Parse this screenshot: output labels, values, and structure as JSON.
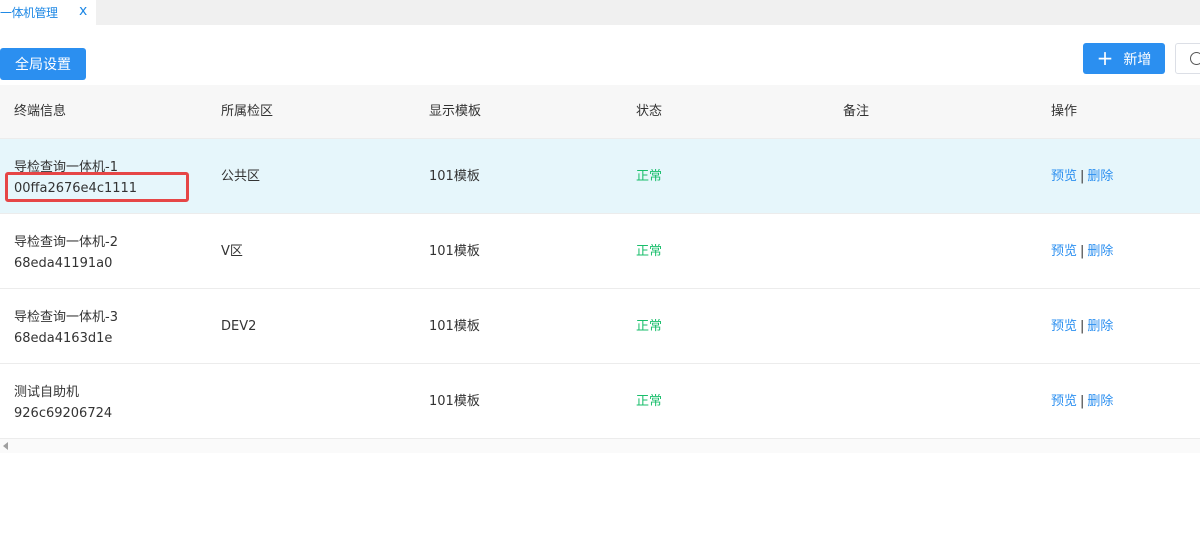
{
  "tabs": [
    {
      "label": "一体机管理",
      "close": "x"
    }
  ],
  "toolbar": {
    "global_settings": "全局设置",
    "add_label": "新增",
    "add_icon": "plus-icon"
  },
  "columns": [
    "终端信息",
    "所属检区",
    "显示模板",
    "状态",
    "备注",
    "操作"
  ],
  "rows": [
    {
      "name": "导检查询一体机-1",
      "id": "00ffa2676e4c1111",
      "area": "公共区",
      "template": "101模板",
      "status": "正常",
      "note": ""
    },
    {
      "name": "导检查询一体机-2",
      "id": "68eda41191a0",
      "area": "V区",
      "template": "101模板",
      "status": "正常",
      "note": ""
    },
    {
      "name": "导检查询一体机-3",
      "id": "68eda4163d1e",
      "area": "DEV2",
      "template": "101模板",
      "status": "正常",
      "note": ""
    },
    {
      "name": "测试自助机",
      "id": "926c69206724",
      "area": "",
      "template": "101模板",
      "status": "正常",
      "note": ""
    }
  ],
  "actions": {
    "preview": "预览",
    "separator": "|",
    "delete": "删除"
  },
  "colors": {
    "primary": "#2b8ff0",
    "status_ok": "#19be6b",
    "selected_row": "#e6f6fb",
    "highlight": "#e64646"
  }
}
